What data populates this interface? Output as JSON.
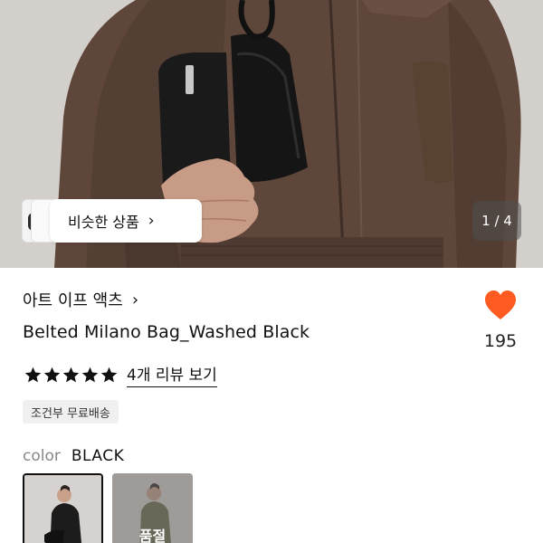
{
  "gallery": {
    "pager": "1 / 4",
    "similar_label": "비슷한 상품",
    "chevron": "›"
  },
  "product": {
    "brand": "아트 이프 액츠",
    "brand_chevron": "›",
    "title": "Belted Milano Bag_Washed Black",
    "likes": "195",
    "rating_stars": 5,
    "review_link": "4개 리뷰 보기",
    "shipping_badge": "조건부 무료배송"
  },
  "options": {
    "color_label": "color",
    "color_value": "BLACK",
    "swatches": [
      {
        "state": "selected"
      },
      {
        "state": "sold-out",
        "label": "품절"
      }
    ]
  },
  "colors": {
    "heart": "#ff5a1f",
    "star": "#111111",
    "jacket": "#5e463b"
  },
  "icons": [
    "chevron-right-icon",
    "heart-icon",
    "star-icon"
  ]
}
